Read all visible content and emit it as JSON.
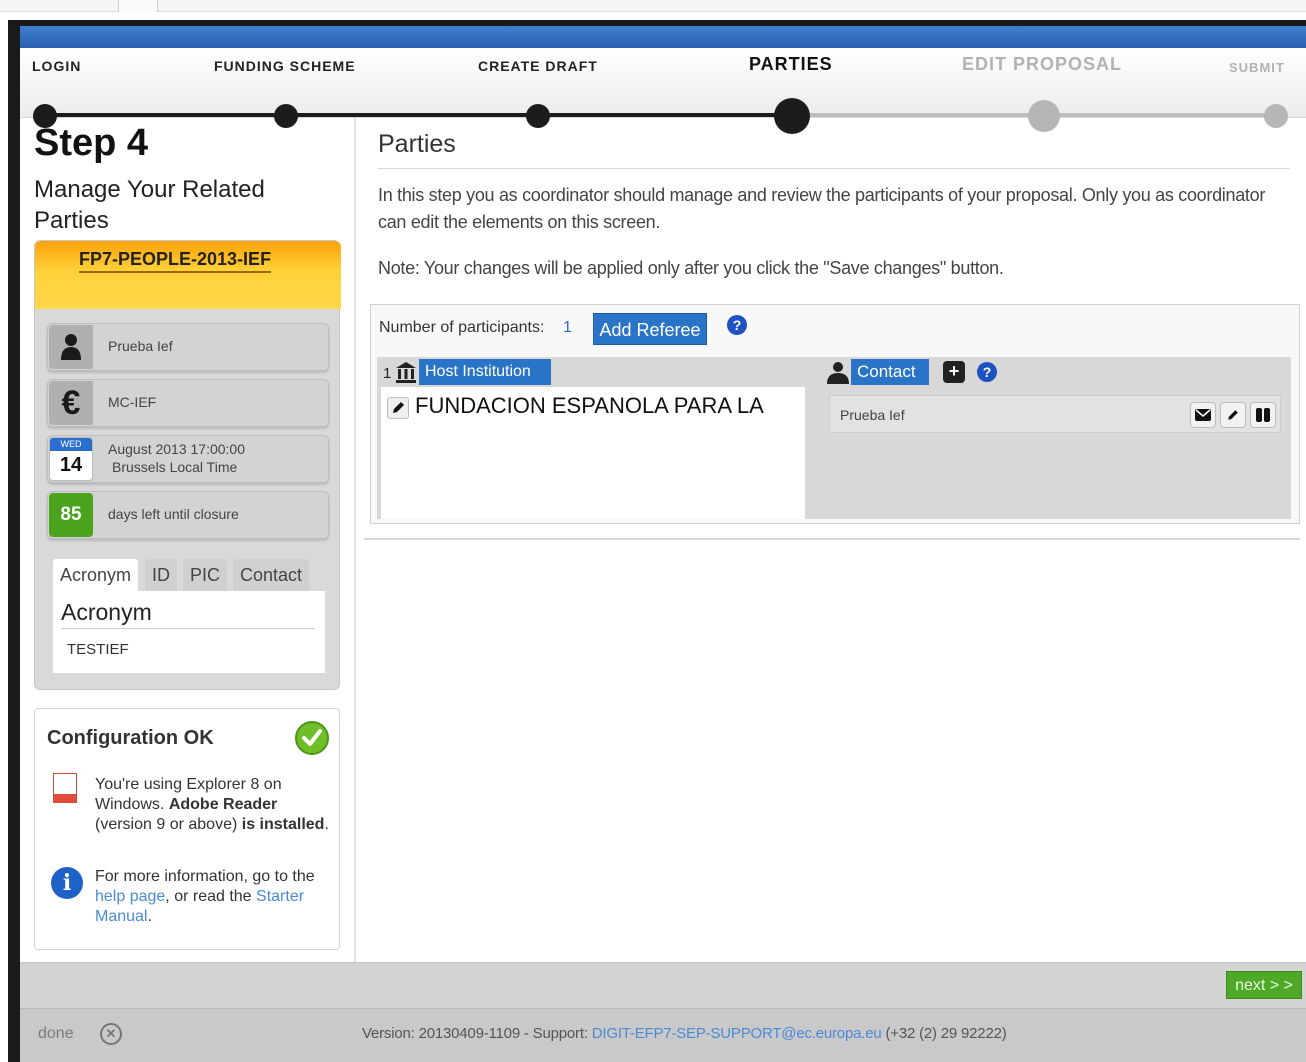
{
  "steps": [
    {
      "label": "LOGIN",
      "state": "done"
    },
    {
      "label": "FUNDING SCHEME",
      "state": "done"
    },
    {
      "label": "CREATE DRAFT",
      "state": "done"
    },
    {
      "label": "PARTIES",
      "state": "current"
    },
    {
      "label": "EDIT PROPOSAL",
      "state": "future"
    },
    {
      "label": "SUBMIT",
      "state": "future"
    }
  ],
  "sidebar": {
    "step_title": "Step 4",
    "step_subtitle": "Manage Your Related Parties",
    "call_id": "FP7-PEOPLE-2013-IEF",
    "user_name": "Prueba Ief",
    "scheme": "MC-IEF",
    "deadline_day_name": "WED",
    "deadline_day": "14",
    "deadline_line1": "August 2013 17:00:00",
    "deadline_line2": "Brussels Local Time",
    "days_left": "85",
    "days_left_label": "days left until closure",
    "tabs": [
      "Acronym",
      "ID",
      "PIC",
      "Contact"
    ],
    "tab_panel_title": "Acronym",
    "tab_panel_value": "TESTIEF"
  },
  "config": {
    "title": "Configuration OK",
    "browser_text_1": "You're using Explorer 8 on Windows.",
    "adobe": "Adobe Reader",
    "version_text": "(version 9 or above)",
    "is_word": "is",
    "installed": "installed",
    "period": ".",
    "more_info_1": "For more information, go to the",
    "help_link": "help page",
    "more_info_2": ", or read the",
    "manual_link": "Starter Manual",
    "more_info_3": "."
  },
  "main": {
    "title": "Parties",
    "description": "In this step you as coordinator should manage and review the participants of your proposal. Only you as coordinator can edit the elements on this screen.",
    "note": "Note: Your changes will be applied only after you click the \"Save changes\" button.",
    "participants_label": "Number of participants:",
    "participants_count": "1",
    "add_referee": "Add Referee",
    "party_number": "1",
    "host_label": "Host Institution",
    "party_name": "FUNDACION ESPANOLA PARA LA",
    "contact_label": "Contact",
    "contact_name": "Prueba Ief"
  },
  "footer": {
    "next": "next > >",
    "done": "done",
    "version": "Version: 20130409-1109 - Support:",
    "support_email": "DIGIT-EFP7-SEP-SUPPORT@ec.europa.eu",
    "phone": "(+32 (2) 29 92222)"
  },
  "colors": {
    "accent_blue": "#2a74c8",
    "call_orange": "#ffb21e",
    "ok_green": "#6fbe28",
    "days_green": "#4aa21d"
  }
}
